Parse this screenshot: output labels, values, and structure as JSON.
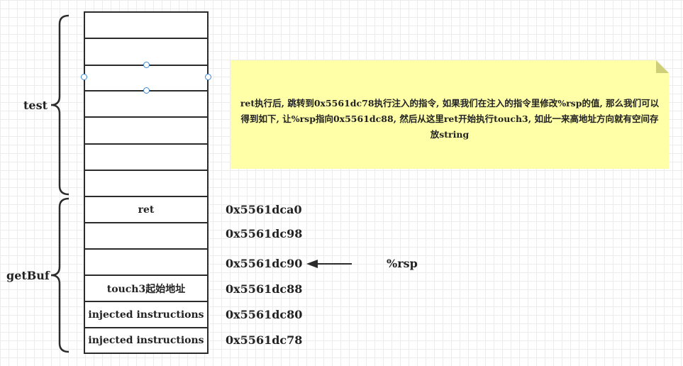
{
  "stack": {
    "empty_cells": [
      "",
      "",
      "",
      "",
      "",
      "",
      ""
    ],
    "cells": [
      {
        "label": "ret",
        "address": "0x5561dca0"
      },
      {
        "label": "",
        "address": "0x5561dc98"
      },
      {
        "label": "",
        "address": "0x5561dc90"
      },
      {
        "label": "touch3起始地址",
        "address": "0x5561dc88"
      },
      {
        "label": "injected instructions",
        "address": "0x5561dc80"
      },
      {
        "label": "injected instructions",
        "address": "0x5561dc78"
      }
    ]
  },
  "braces": {
    "test": "test",
    "getbuf": "getBuf"
  },
  "pointer": {
    "label": "%rsp"
  },
  "note": {
    "text": "ret执行后, 跳转到0x5561dc78执行注入的指令, 如果我们在注入的指令里修改%rsp的值, 那么我们可以得到如下, 让%rsp指向0x5561dc88, 然后从这里ret开始执行touch3, 如此一来高地址方向就有空间存放string",
    "color": "#ffffa8"
  }
}
